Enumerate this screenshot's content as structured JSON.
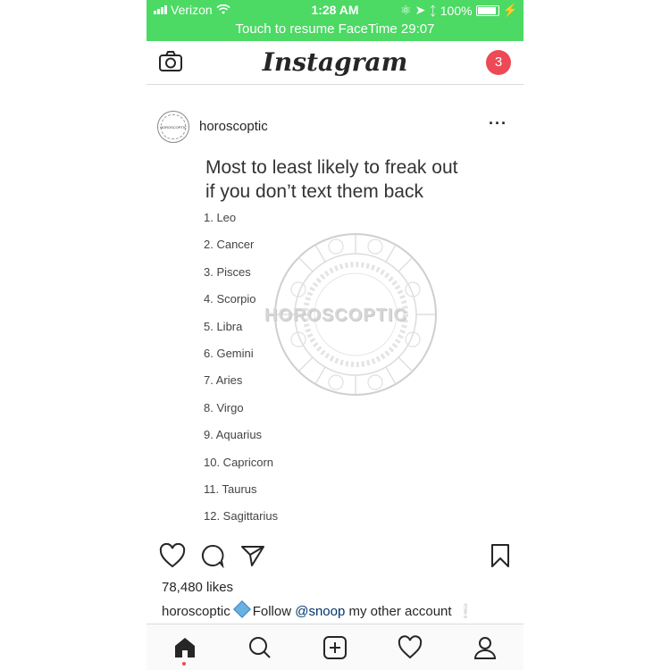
{
  "status_bar": {
    "carrier": "Verizon",
    "time": "1:28 AM",
    "battery": "100%",
    "bg_color": "#4cd964"
  },
  "facetime_banner": "Touch to resume FaceTime 29:07",
  "header": {
    "logo": "Instagram",
    "notification_count": "3",
    "camera_icon": "camera-icon"
  },
  "post": {
    "username": "horoscoptic",
    "avatar_text": "HOROSCOPTIC",
    "image": {
      "title_line1": "Most to least likely to freak out",
      "title_line2": "if you don’t text them back",
      "watermark": "HOROSCOPTIC",
      "list": [
        "1. Leo",
        "2. Cancer",
        "3. Pisces",
        "4. Scorpio",
        "5. Libra",
        "6. Gemini",
        "7. Aries",
        "8. Virgo",
        "9. Aquarius",
        "10. Capricorn",
        "11. Taurus",
        "12. Sagittarius"
      ]
    },
    "likes": "78,480 likes",
    "caption": {
      "username": "horoscoptic",
      "text_before": "Follow ",
      "mention": "@snoop",
      "text_after": " my other account",
      "excl": "❕"
    }
  },
  "tabbar": {
    "items": [
      "home-icon",
      "search-icon",
      "add-post-icon",
      "activity-heart-icon",
      "profile-icon"
    ]
  }
}
